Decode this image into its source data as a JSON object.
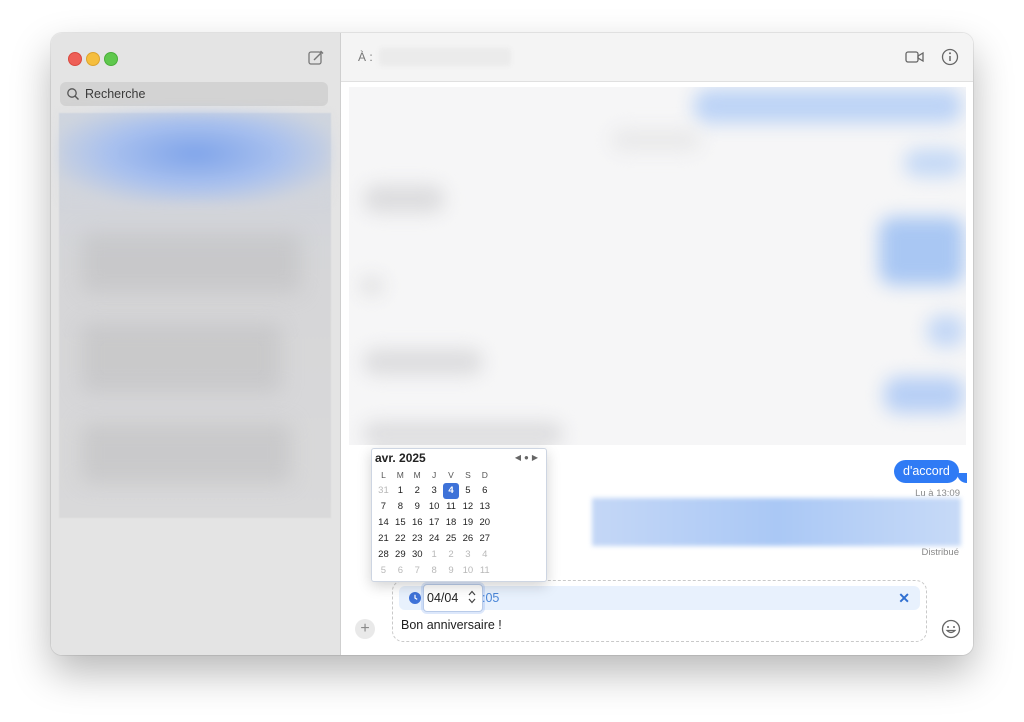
{
  "sidebar": {
    "search": {
      "placeholder": "Recherche"
    }
  },
  "header": {
    "to_label": "À :",
    "video_icon": "video-camera-icon",
    "info_icon": "info-icon"
  },
  "conversation": {
    "last_message": "d'accord",
    "read_status": "Lu à 13:09",
    "delivered_status": "Distribué"
  },
  "composer": {
    "scheduled_date": "04/04",
    "scheduled_time_tail": ":05",
    "message_text": "Bon anniversaire !",
    "cancel_label": "✕",
    "plus_label": "+"
  },
  "calendar": {
    "month_label": "avr. 2025",
    "weekdays": [
      "L",
      "M",
      "M",
      "J",
      "V",
      "S",
      "D"
    ],
    "weeks": [
      [
        "31",
        "1",
        "2",
        "3",
        "4",
        "5",
        "6"
      ],
      [
        "7",
        "8",
        "9",
        "10",
        "11",
        "12",
        "13"
      ],
      [
        "14",
        "15",
        "16",
        "17",
        "18",
        "19",
        "20"
      ],
      [
        "21",
        "22",
        "23",
        "24",
        "25",
        "26",
        "27"
      ],
      [
        "28",
        "29",
        "30",
        "1",
        "2",
        "3",
        "4"
      ],
      [
        "5",
        "6",
        "7",
        "8",
        "9",
        "10",
        "11"
      ]
    ],
    "selected_day": "4",
    "accent_color": "#3e72d8"
  },
  "colors": {
    "bubble_blue": "#2f7bf5",
    "sidebar_bg": "#e4e4e4"
  }
}
